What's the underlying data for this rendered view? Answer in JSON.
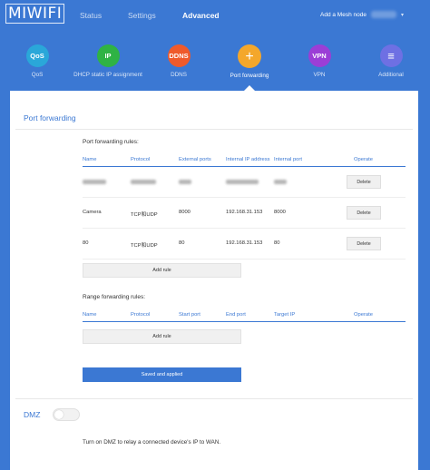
{
  "header": {
    "logo": "MIWIFI",
    "nav": {
      "status": "Status",
      "settings": "Settings",
      "advanced": "Advanced"
    },
    "mesh_link": "Add a Mesh node",
    "user_caret": "▾"
  },
  "features": [
    {
      "icon_text": "QoS",
      "label": "QoS",
      "color": "#2aa7d9"
    },
    {
      "icon_text": "IP",
      "label": "DHCP static IP assignment",
      "color": "#2fb344"
    },
    {
      "icon_text": "DDNS",
      "label": "DDNS",
      "color": "#ef5a2b"
    },
    {
      "icon_text": "+",
      "label": "Port forwarding",
      "color": "#f4a72b"
    },
    {
      "icon_text": "VPN",
      "label": "VPN",
      "color": "#9b3ed6"
    },
    {
      "icon_text": "≡",
      "label": "Additional",
      "color": "#6e70e3"
    }
  ],
  "port_forwarding": {
    "title": "Port forwarding",
    "rules_title": "Port forwarding rules:",
    "columns": [
      "Name",
      "Protocol",
      "External ports",
      "Internal IP address",
      "Internal port",
      "Operate"
    ],
    "rows": [
      {
        "name": "",
        "protocol": "",
        "external": "",
        "ip": "",
        "internal": "",
        "action": "Delete"
      },
      {
        "name": "Camera",
        "protocol": "TCP和UDP",
        "external": "8000",
        "ip": "192.168.31.153",
        "internal": "8000",
        "action": "Delete"
      },
      {
        "name": "80",
        "protocol": "TCP和UDP",
        "external": "80",
        "ip": "192.168.31.153",
        "internal": "80",
        "action": "Delete"
      }
    ],
    "add_rule": "Add rule",
    "range_title": "Range forwarding rules:",
    "range_columns": [
      "Name",
      "Protocol",
      "Start port",
      "End port",
      "Target IP",
      "Operate"
    ],
    "range_add_rule": "Add rule",
    "save": "Saved and applied"
  },
  "dmz": {
    "title": "DMZ",
    "enabled": false,
    "description": "Turn on DMZ to relay a connected device's IP to WAN."
  }
}
